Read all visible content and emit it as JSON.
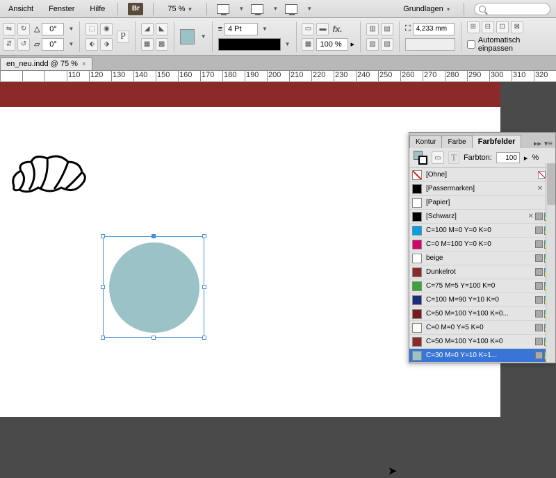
{
  "menu": {
    "view": "Ansicht",
    "window": "Fenster",
    "help": "Hilfe"
  },
  "bridge": "Br",
  "zoom": "75 %",
  "workspace": "Grundlagen",
  "control": {
    "angle1": "0°",
    "angle2": "0°",
    "fillColor": "#9bc2c7",
    "strokeWeight": "4 Pt",
    "opacity": "100 %",
    "dim": "4,233 mm",
    "autofit": "Automatisch einpassen"
  },
  "docTab": "en_neu.indd @ 75 %",
  "rulerTicks": [
    "",
    "",
    "",
    "110",
    "120",
    "130",
    "140",
    "150",
    "160",
    "170",
    "180",
    "190",
    "200",
    "210",
    "220",
    "230",
    "240",
    "250",
    "260",
    "270",
    "280",
    "290",
    "300",
    "310",
    "320"
  ],
  "panel": {
    "tabs": {
      "stroke": "Kontur",
      "color": "Farbe",
      "swatches": "Farbfelder"
    },
    "tintLabel": "Farbton:",
    "tintValue": "100",
    "tintPct": "%"
  },
  "swatches": [
    {
      "name": "[Ohne]",
      "chip": "none",
      "locked": true,
      "reg": false,
      "cmyk": false,
      "none": true
    },
    {
      "name": "[Passermarken]",
      "chip": "#000000",
      "locked": true,
      "reg": true,
      "cmyk": false
    },
    {
      "name": "[Papier]",
      "chip": "#ffffff",
      "locked": false,
      "reg": false,
      "cmyk": false
    },
    {
      "name": "[Schwarz]",
      "chip": "#000000",
      "locked": true,
      "reg": false,
      "cmyk": true
    },
    {
      "name": "C=100 M=0 Y=0 K=0",
      "chip": "#00a0e3",
      "locked": false,
      "reg": false,
      "cmyk": true
    },
    {
      "name": "C=0 M=100 Y=0 K=0",
      "chip": "#d6006c",
      "locked": false,
      "reg": false,
      "cmyk": true
    },
    {
      "name": "beige",
      "chip": "#ffffff",
      "locked": false,
      "reg": false,
      "cmyk": true
    },
    {
      "name": "Dunkelrot",
      "chip": "#8c2a2a",
      "locked": false,
      "reg": false,
      "cmyk": true
    },
    {
      "name": "C=75 M=5 Y=100 K=0",
      "chip": "#3aa535",
      "locked": false,
      "reg": false,
      "cmyk": true
    },
    {
      "name": "C=100 M=90 Y=10 K=0",
      "chip": "#1c2e7a",
      "locked": false,
      "reg": false,
      "cmyk": true
    },
    {
      "name": "C=50 M=100 Y=100 K=0...",
      "chip": "#7a1a1a",
      "locked": false,
      "reg": false,
      "cmyk": true
    },
    {
      "name": "C=0 M=0 Y=5 K=0",
      "chip": "#fffef5",
      "locked": false,
      "reg": false,
      "cmyk": true
    },
    {
      "name": "C=50 M=100 Y=100 K=0",
      "chip": "#8c2a2a",
      "locked": false,
      "reg": false,
      "cmyk": true
    },
    {
      "name": "C=30 M=0 Y=10 K=1...",
      "chip": "#9bc2c7",
      "locked": false,
      "reg": false,
      "cmyk": true,
      "selected": true
    }
  ]
}
